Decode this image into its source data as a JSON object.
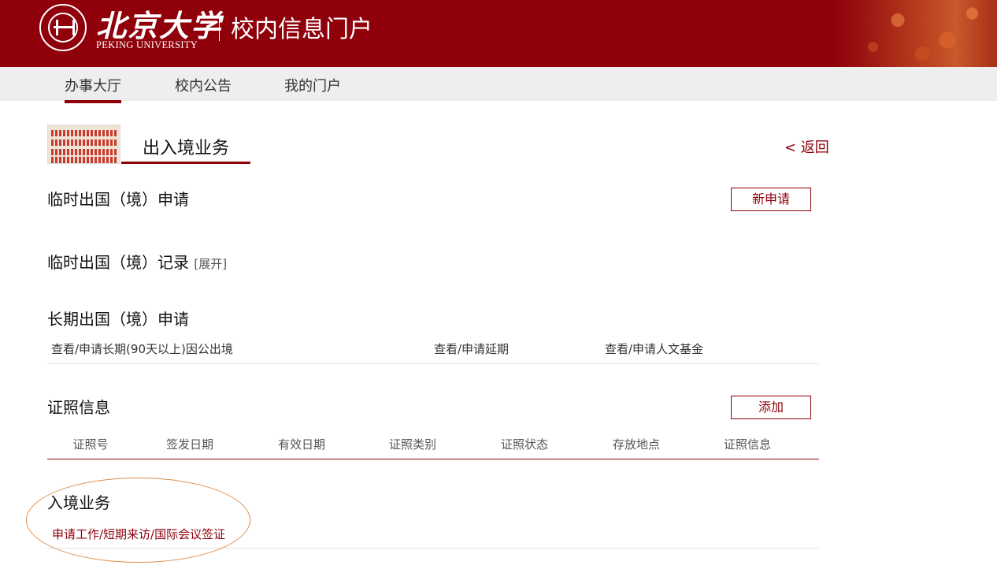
{
  "header": {
    "logo_cn": "北京大学",
    "logo_en": "PEKING UNIVERSITY",
    "portal_title": "校内信息门户",
    "brand_color": "#8f000b"
  },
  "nav": {
    "items": [
      {
        "label": "办事大厅",
        "active": true
      },
      {
        "label": "校内公告",
        "active": false
      },
      {
        "label": "我的门户",
        "active": false
      }
    ]
  },
  "page": {
    "section_title": "出入境业务",
    "back_label": "< 返回"
  },
  "temp_apply": {
    "title": "临时出国（境）申请",
    "button": "新申请"
  },
  "temp_record": {
    "title": "临时出国（境）记录",
    "expand": "[展开]"
  },
  "long_term": {
    "title": "长期出国（境）申请",
    "links": [
      "查看/申请长期(90天以上)因公出境",
      "查看/申请延期",
      "查看/申请人文基金"
    ]
  },
  "certificates": {
    "title": "证照信息",
    "button": "添加",
    "columns": [
      "证照号",
      "签发日期",
      "有效日期",
      "证照类别",
      "证照状态",
      "存放地点",
      "证照信息"
    ]
  },
  "entry": {
    "title": "入境业务",
    "link": "申请工作/短期来访/国际会议签证",
    "highlight_color": "#e08c48"
  }
}
